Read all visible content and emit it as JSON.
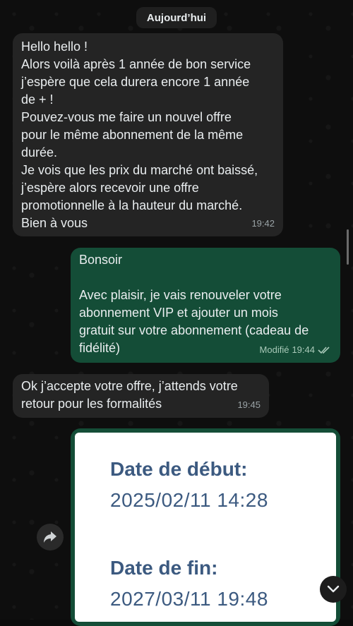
{
  "chat": {
    "date_chip": "Aujourd’hui",
    "messages": [
      {
        "direction": "in",
        "text": "Hello hello !\nAlors voilà après 1 année de bon service\nj’espère que cela durera encore 1 année\nde + !\nPouvez-vous me faire un nouvel offre\npour le même abonnement de la même\ndurée.\nJe vois que les prix du marché ont baissé,\nj’espère alors recevoir une offre\npromotionnelle à la hauteur du marché.\nBien à vous",
        "time": "19:42"
      },
      {
        "direction": "out",
        "text": "Bonsoir\n\nAvec plaisir, je vais renouveler votre\nabonnement VIP et ajouter un mois\ngratuit sur votre abonnement (cadeau de\nfidélité)",
        "edited_label": "Modifié",
        "time": "19:44",
        "status": "read"
      },
      {
        "direction": "in",
        "text": "Ok j’accepte votre offre, j’attends votre\nretour pour les formalités",
        "time": "19:45"
      }
    ],
    "image_message": {
      "start_label": "Date de début:",
      "start_value": "2025/02/11 14:28",
      "end_label": "Date de fin:",
      "end_value": "2027/03/11 19:48"
    }
  },
  "icons": {
    "forward": "forward-arrow-icon",
    "scroll_down": "chevron-down-icon",
    "read_receipt": "double-check-icon"
  },
  "colors": {
    "incoming_bubble": "#242424",
    "outgoing_bubble": "#144d37",
    "background": "#0b0b0b",
    "image_text": "#3c5a80"
  }
}
